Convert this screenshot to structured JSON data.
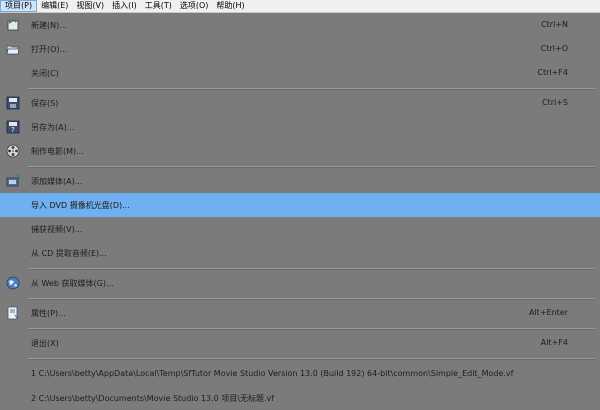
{
  "menubar": {
    "items": [
      "项目(P)",
      "编辑(E)",
      "视图(V)",
      "插入(I)",
      "工具(T)",
      "选项(O)",
      "帮助(H)"
    ]
  },
  "menu": {
    "items": [
      {
        "label": "新建(N)...",
        "shortcut": "Ctrl+N",
        "icon": "new-project-icon"
      },
      {
        "label": "打开(O)...",
        "shortcut": "Ctrl+O",
        "icon": "open-folder-icon"
      },
      {
        "label": "关闭(C)",
        "shortcut": "Ctrl+F4",
        "icon": ""
      },
      {
        "label": "保存(S)",
        "shortcut": "Ctrl+S",
        "icon": "save-disk-icon"
      },
      {
        "label": "另存为(A)...",
        "shortcut": "",
        "icon": "save-as-icon"
      },
      {
        "label": "制作电影(M)...",
        "shortcut": "",
        "icon": "film-reel-icon"
      },
      {
        "label": "添加媒体(A)...",
        "shortcut": "",
        "icon": "add-media-icon"
      },
      {
        "label": "导入 DVD 摄像机光盘(D)...",
        "shortcut": "",
        "icon": ""
      },
      {
        "label": "捕获视频(V)...",
        "shortcut": "",
        "icon": ""
      },
      {
        "label": "从 CD 提取音频(E)...",
        "shortcut": "",
        "icon": ""
      },
      {
        "label": "从 Web 获取媒体(G)...",
        "shortcut": "",
        "icon": "web-globe-icon"
      },
      {
        "label": "属性(P)...",
        "shortcut": "Alt+Enter",
        "icon": "properties-icon"
      },
      {
        "label": "退出(X)",
        "shortcut": "Alt+F4",
        "icon": ""
      },
      {
        "label": "1 C:\\Users\\betty\\AppData\\Local\\Temp\\SfTutor Movie Studio Version 13.0 (Build 192) 64-bit\\common\\Simple_Edit_Mode.vf",
        "shortcut": "",
        "icon": ""
      },
      {
        "label": "2 C:\\Users\\betty\\Documents\\Movie Studio 13.0 项目\\无标题.vf",
        "shortcut": "",
        "icon": ""
      }
    ],
    "highlighted_index": 7,
    "highlight_color": "#6fb0f0",
    "background_color": "#7b7b7b"
  }
}
